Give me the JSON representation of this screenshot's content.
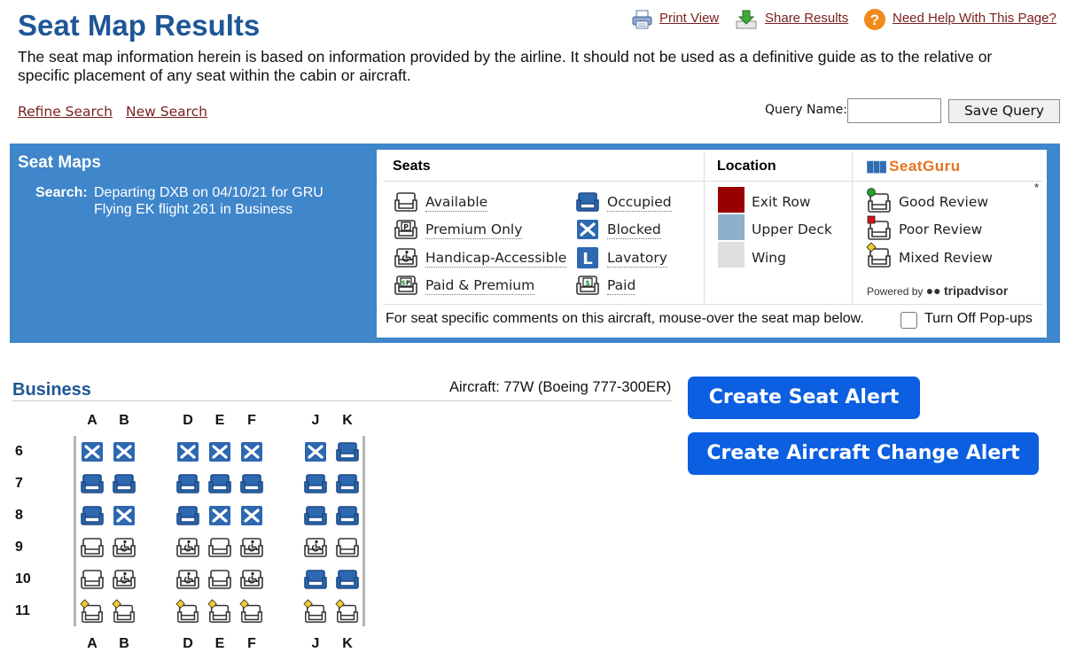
{
  "page": {
    "title": "Seat Map Results",
    "disclaimer": "The seat map information herein is based on information provided by the airline. It should not be used as a definitive guide as to the relative or specific placement of any seat within the cabin or aircraft."
  },
  "top_links": {
    "print": "Print View",
    "share": "Share Results",
    "help": "Need Help With This Page?"
  },
  "nav": {
    "refine": "Refine Search",
    "new": "New Search"
  },
  "query": {
    "label": "Query Name:",
    "value": "",
    "save_label": "Save Query"
  },
  "banner": {
    "title": "Seat Maps",
    "search_label": "Search:",
    "line1": "Departing DXB on 04/10/21 for GRU",
    "line2": "Flying EK flight 261 in Business"
  },
  "legend": {
    "seats_header": "Seats",
    "location_header": "Location",
    "seats_left": [
      "Available",
      "Premium Only",
      "Handicap-Accessible",
      "Paid & Premium"
    ],
    "seats_right": [
      "Occupied",
      "Blocked",
      "Lavatory",
      "Paid"
    ],
    "location": [
      {
        "label": "Exit Row",
        "color": "#990000"
      },
      {
        "label": "Upper Deck",
        "color": "#8fb0cb"
      },
      {
        "label": "Wing",
        "color": "#dedede"
      }
    ],
    "seatguru_brand": "SeatGuru",
    "reviews": [
      "Good Review",
      "Poor Review",
      "Mixed Review"
    ],
    "review_colors": {
      "good": "#1fa32b",
      "poor": "#d8121b",
      "mixed": "#f2cb2c"
    },
    "asterisk": "*",
    "powered_by": "Powered by",
    "tripadvisor": "tripadvisor",
    "popup_note": "For seat specific comments on this aircraft, mouse-over the seat map below.",
    "popup_toggle": "Turn Off Pop-ups",
    "popup_checked": false
  },
  "cabin": {
    "title": "Business",
    "aircraft": "Aircraft: 77W (Boeing 777-300ER)",
    "columns": [
      "A",
      "B",
      "D",
      "E",
      "F",
      "J",
      "K"
    ],
    "rows": [
      {
        "label": "6",
        "seats": [
          "blocked",
          "blocked",
          "blocked",
          "blocked",
          "blocked",
          "blocked",
          "occupied"
        ]
      },
      {
        "label": "7",
        "seats": [
          "occupied",
          "occupied",
          "occupied",
          "occupied",
          "occupied",
          "occupied",
          "occupied"
        ]
      },
      {
        "label": "8",
        "seats": [
          "occupied",
          "blocked",
          "occupied",
          "blocked",
          "blocked",
          "occupied",
          "occupied"
        ]
      },
      {
        "label": "9",
        "seats": [
          "available",
          "handicap",
          "handicap",
          "available",
          "handicap",
          "handicap",
          "available"
        ]
      },
      {
        "label": "10",
        "seats": [
          "available",
          "handicap",
          "handicap",
          "available",
          "handicap",
          "occupied",
          "occupied"
        ]
      },
      {
        "label": "11",
        "seats": [
          "mixed",
          "mixed",
          "mixed",
          "mixed",
          "mixed",
          "mixed",
          "mixed"
        ]
      }
    ]
  },
  "alerts": {
    "seat_alert": "Create Seat Alert",
    "aircraft_alert": "Create Aircraft Change Alert"
  },
  "colors": {
    "title_blue": "#1f5696",
    "banner_blue": "#3f86cb",
    "link_red": "#7a1f1f",
    "seat_blue": "#2d68b0",
    "button_blue": "#0b5fe0"
  }
}
